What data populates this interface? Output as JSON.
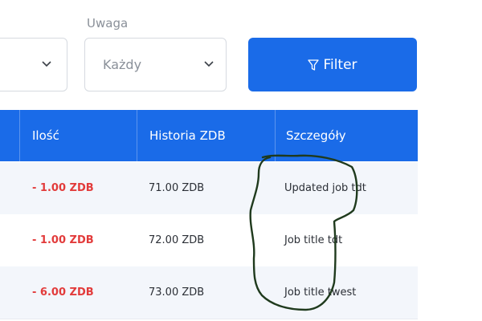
{
  "filters": {
    "uwaga_label": "Uwaga",
    "uwaga_value": "Każdy",
    "filter_button_label": "Filter"
  },
  "table": {
    "columns": [
      "Ilość",
      "Historia ZDB",
      "Szczegóły"
    ],
    "rows": [
      {
        "amount": "- 1.00 ZDB",
        "history": "71.00 ZDB",
        "details": "Updated job tdt"
      },
      {
        "amount": "- 1.00 ZDB",
        "history": "72.00 ZDB",
        "details": "Job title tdt"
      },
      {
        "amount": "- 6.00 ZDB",
        "history": "73.00 ZDB",
        "details": "Job title twest"
      }
    ]
  },
  "colors": {
    "primary": "#1a6be8",
    "negative_amount": "#e23b3b",
    "annotation_stroke": "#1f3a1d"
  },
  "icons": {
    "select_chevron": "chevron-down-icon",
    "filter": "funnel-icon"
  }
}
